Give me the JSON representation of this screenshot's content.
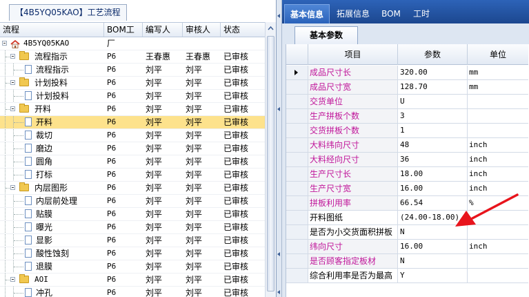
{
  "left_panel": {
    "tab_label": "【4B5YQ05KAO】工艺流程",
    "columns": [
      "流程",
      "BOM工厂",
      "编写人",
      "审核人",
      "状态"
    ],
    "root": "4B5YQ05KAO",
    "rows": [
      {
        "name": "流程指示",
        "kind": "folder",
        "level": 1,
        "expanded": true,
        "bom": "P6",
        "writer": "王春惠",
        "reviewer": "王春惠",
        "status": "已审核"
      },
      {
        "name": "流程指示",
        "kind": "doc",
        "level": 2,
        "bom": "P6",
        "writer": "刘平",
        "reviewer": "刘平",
        "status": "已审核"
      },
      {
        "name": "计划投料",
        "kind": "folder",
        "level": 1,
        "expanded": true,
        "bom": "P6",
        "writer": "刘平",
        "reviewer": "刘平",
        "status": "已审核"
      },
      {
        "name": "计划投料",
        "kind": "doc",
        "level": 2,
        "bom": "P6",
        "writer": "刘平",
        "reviewer": "刘平",
        "status": "已审核"
      },
      {
        "name": "开料",
        "kind": "folder",
        "level": 1,
        "expanded": true,
        "bom": "P6",
        "writer": "刘平",
        "reviewer": "刘平",
        "status": "已审核"
      },
      {
        "name": "开料",
        "kind": "doc",
        "level": 2,
        "bom": "P6",
        "writer": "刘平",
        "reviewer": "刘平",
        "status": "已审核",
        "selected": true
      },
      {
        "name": "裁切",
        "kind": "doc",
        "level": 2,
        "bom": "P6",
        "writer": "刘平",
        "reviewer": "刘平",
        "status": "已审核"
      },
      {
        "name": "磨边",
        "kind": "doc",
        "level": 2,
        "bom": "P6",
        "writer": "刘平",
        "reviewer": "刘平",
        "status": "已审核"
      },
      {
        "name": "圆角",
        "kind": "doc",
        "level": 2,
        "bom": "P6",
        "writer": "刘平",
        "reviewer": "刘平",
        "status": "已审核"
      },
      {
        "name": "打标",
        "kind": "doc",
        "level": 2,
        "bom": "P6",
        "writer": "刘平",
        "reviewer": "刘平",
        "status": "已审核"
      },
      {
        "name": "内层图形",
        "kind": "folder",
        "level": 1,
        "expanded": true,
        "bom": "P6",
        "writer": "刘平",
        "reviewer": "刘平",
        "status": "已审核"
      },
      {
        "name": "内层前处理",
        "kind": "doc",
        "level": 2,
        "bom": "P6",
        "writer": "刘平",
        "reviewer": "刘平",
        "status": "已审核"
      },
      {
        "name": "贴膜",
        "kind": "doc",
        "level": 2,
        "bom": "P6",
        "writer": "刘平",
        "reviewer": "刘平",
        "status": "已审核"
      },
      {
        "name": "曝光",
        "kind": "doc",
        "level": 2,
        "bom": "P6",
        "writer": "刘平",
        "reviewer": "刘平",
        "status": "已审核"
      },
      {
        "name": "显影",
        "kind": "doc",
        "level": 2,
        "bom": "P6",
        "writer": "刘平",
        "reviewer": "刘平",
        "status": "已审核"
      },
      {
        "name": "酸性蚀刻",
        "kind": "doc",
        "level": 2,
        "bom": "P6",
        "writer": "刘平",
        "reviewer": "刘平",
        "status": "已审核"
      },
      {
        "name": "退膜",
        "kind": "doc",
        "level": 2,
        "bom": "P6",
        "writer": "刘平",
        "reviewer": "刘平",
        "status": "已审核"
      },
      {
        "name": "AOI",
        "kind": "folder",
        "level": 1,
        "expanded": true,
        "bom": "P6",
        "writer": "刘平",
        "reviewer": "刘平",
        "status": "已审核"
      },
      {
        "name": "冲孔",
        "kind": "doc",
        "level": 2,
        "bom": "P6",
        "writer": "刘平",
        "reviewer": "刘平",
        "status": "已审核"
      }
    ]
  },
  "right_panel": {
    "top_tabs": [
      "基本信息",
      "拓展信息",
      "BOM",
      "工时"
    ],
    "active_top_tab": "基本信息",
    "sub_tab": "基本参数",
    "grid_columns": [
      "项目",
      "参数",
      "单位"
    ],
    "rows": [
      {
        "item": "成品尺寸长",
        "value": "320.00",
        "unit": "mm",
        "highlight": true,
        "current": true
      },
      {
        "item": "成品尺寸宽",
        "value": "128.70",
        "unit": "mm",
        "highlight": true
      },
      {
        "item": "交货单位",
        "value": "U",
        "unit": "",
        "highlight": true
      },
      {
        "item": "生产拼板个数",
        "value": "3",
        "unit": "",
        "highlight": true
      },
      {
        "item": "交货拼板个数",
        "value": "1",
        "unit": "",
        "highlight": true
      },
      {
        "item": "大料纬向尺寸",
        "value": "48",
        "unit": "inch",
        "highlight": true
      },
      {
        "item": "大料经向尺寸",
        "value": "36",
        "unit": "inch",
        "highlight": true
      },
      {
        "item": "生产尺寸长",
        "value": "18.00",
        "unit": "inch",
        "highlight": true
      },
      {
        "item": "生产尺寸宽",
        "value": "16.00",
        "unit": "inch",
        "highlight": true
      },
      {
        "item": "拼板利用率",
        "value": "66.54",
        "unit": "%",
        "highlight": true
      },
      {
        "item": "开料图纸",
        "value": "(24.00-18.00)",
        "unit": "",
        "highlight": false
      },
      {
        "item": "是否为小交货面积拼板",
        "value": "N",
        "unit": "",
        "highlight": false
      },
      {
        "item": "纬向尺寸",
        "value": "16.00",
        "unit": "inch",
        "highlight": true
      },
      {
        "item": "是否顾客指定板材",
        "value": "N",
        "unit": "",
        "highlight": true
      },
      {
        "item": "综合利用率是否为最高",
        "value": "Y",
        "unit": "",
        "highlight": false
      }
    ]
  },
  "colors": {
    "tab_bar": "#1c478f",
    "selected_row": "#fde28c",
    "highlight_text": "#c0169a",
    "annotation_arrow": "#e8141c"
  }
}
